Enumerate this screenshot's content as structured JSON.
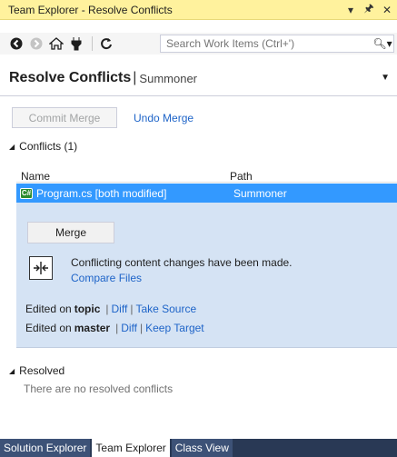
{
  "window": {
    "title": "Team Explorer - Resolve Conflicts",
    "pin_icon": "pin-icon",
    "close_icon": "close-icon",
    "dropdown_icon": "dropdown-arrow-icon"
  },
  "toolbar": {
    "icons": [
      "back-icon",
      "forward-icon",
      "home-icon",
      "connect-icon",
      "refresh-icon"
    ],
    "search_placeholder": "Search Work Items (Ctrl+')",
    "search_icon": "search-icon"
  },
  "header": {
    "title": "Resolve Conflicts",
    "separator": "|",
    "subtitle": "Summoner"
  },
  "actions": {
    "commit_merge": "Commit Merge",
    "undo_merge": "Undo Merge"
  },
  "conflicts": {
    "section_label": "Conflicts (1)",
    "columns": {
      "name": "Name",
      "path": "Path"
    },
    "row": {
      "name": "Program.cs [both modified]",
      "path": "Summoner",
      "icon": "csharp-file-icon"
    },
    "merge_button": "Merge",
    "message": "Conflicting content changes have been made.",
    "compare_files": "Compare Files",
    "edited_on_label": "Edited on",
    "topic": {
      "branch": "topic",
      "diff": "Diff",
      "action": "Take Source"
    },
    "master": {
      "branch": "master",
      "diff": "Diff",
      "action": "Keep Target"
    },
    "pipe": "|"
  },
  "resolved": {
    "section_label": "Resolved",
    "empty_text": "There are no resolved conflicts"
  },
  "tabs": [
    "Solution Explorer",
    "Team Explorer",
    "Class View"
  ],
  "colors": {
    "titlebar": "#fff29d",
    "selection": "#3399ff",
    "details_bg": "#d5e3f4",
    "link": "#1e64c8",
    "tabbar": "#293955"
  }
}
